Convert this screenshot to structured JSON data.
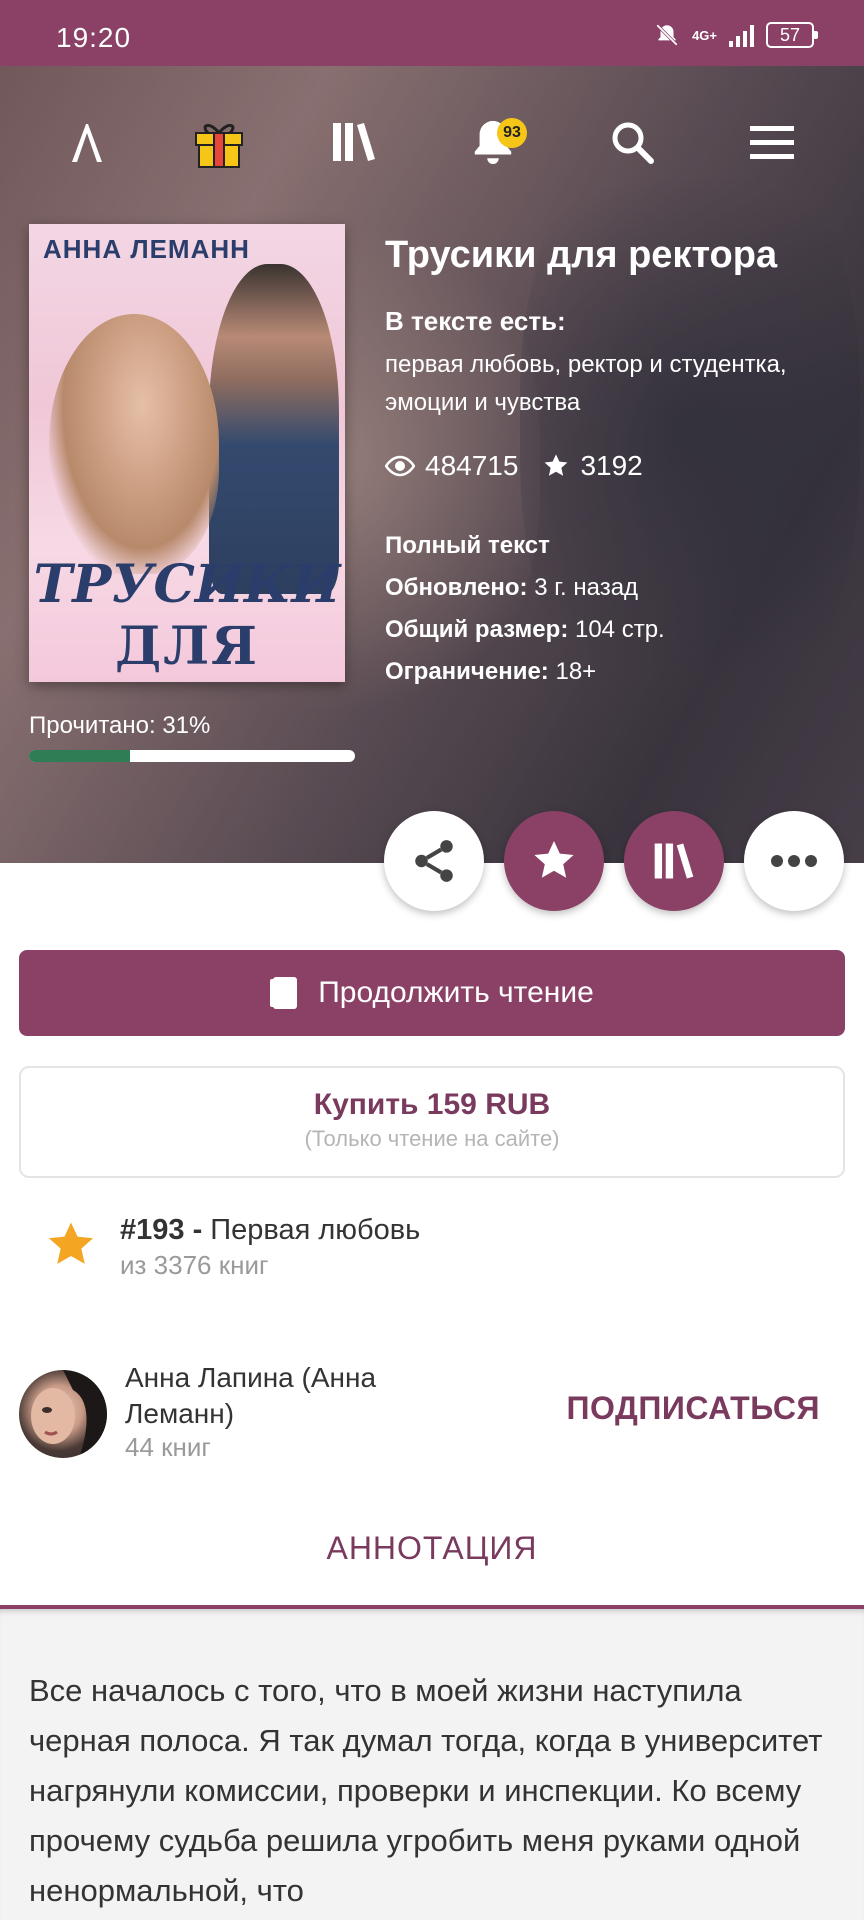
{
  "status": {
    "time": "19:20",
    "battery": "57",
    "network": "4G+"
  },
  "nav": {
    "notifications_count": "93"
  },
  "book": {
    "cover_author": "АННА ЛЕМАНН",
    "cover_title_line1": "ТРУСИКИ",
    "cover_title_line2": "ДЛЯ РЕКТОРА",
    "title": "Трусики для ректора",
    "tags_label": "В тексте есть:",
    "tags_value": "первая любовь, ректор и студентка, эмоции и чувства",
    "views": "484715",
    "stars": "3192",
    "status": "Полный текст",
    "updated_label": "Обновлено:",
    "updated_value": "3 г. назад",
    "size_label": "Общий размер:",
    "size_value": "104 стр.",
    "restriction_label": "Ограничение:",
    "restriction_value": "18+",
    "progress_label": "Прочитано: 31%",
    "progress_fraction": 0.31
  },
  "actions": {
    "continue_label": "Продолжить чтение",
    "buy_label": "Купить 159 RUB",
    "buy_note": "(Только чтение на сайте)"
  },
  "rank": {
    "position": "#193 -",
    "genre": "Первая любовь",
    "of_total": "из 3376 книг"
  },
  "author": {
    "name": "Анна Лапина (Анна Леманн)",
    "books": "44 книг",
    "subscribe_label": "ПОДПИСАТЬСЯ"
  },
  "tabs": {
    "annotation_label": "АННОТАЦИЯ"
  },
  "annotation": {
    "text": "Все началось с того, что в моей жизни наступила черная полоса. Я так думал тогда, когда в университет нагрянули комиссии, проверки и инспекции. Ко всему прочему судьба решила угробить меня руками одной ненормальной, что"
  },
  "colors": {
    "brand": "#8b4166",
    "progress": "#2e7d54",
    "badge": "#f5c518",
    "star": "#f4a623"
  }
}
